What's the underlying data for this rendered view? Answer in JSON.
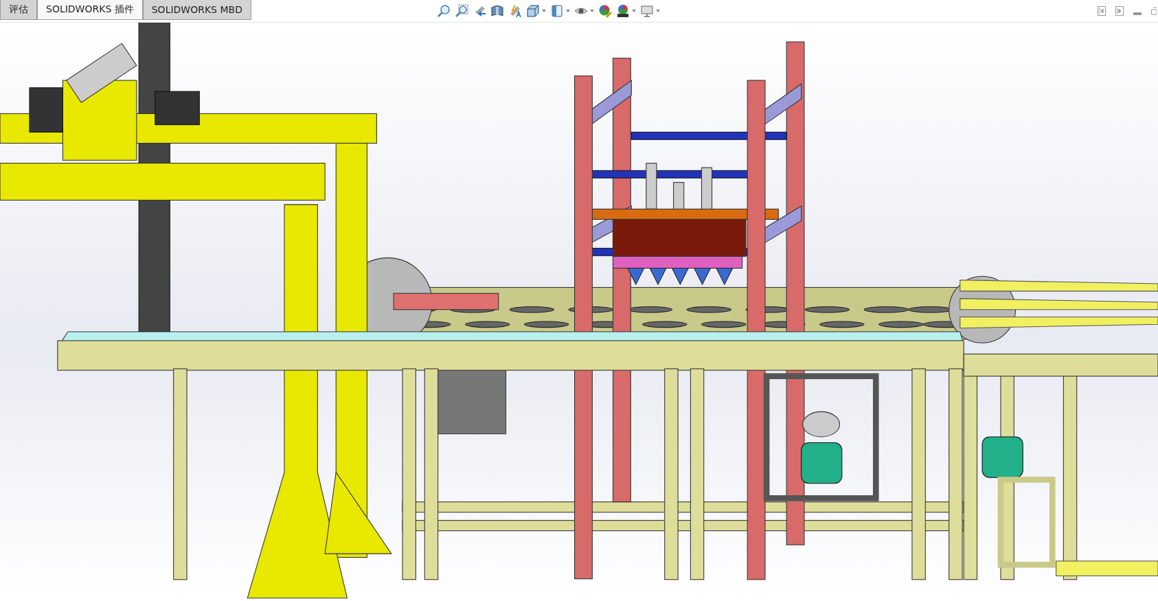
{
  "tabs": [
    {
      "label": "评估",
      "selected": false
    },
    {
      "label": "SOLIDWORKS 插件",
      "selected": true
    },
    {
      "label": "SOLIDWORKS MBD",
      "selected": false
    }
  ]
}
